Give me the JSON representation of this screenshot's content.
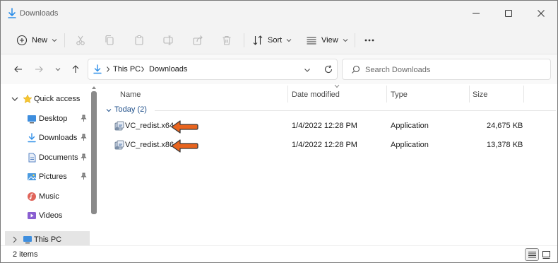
{
  "window": {
    "title": "Downloads"
  },
  "commandbar": {
    "new_label": "New",
    "sort_label": "Sort",
    "view_label": "View"
  },
  "address": {
    "crumbs": [
      "This PC",
      "Downloads"
    ]
  },
  "search": {
    "placeholder": "Search Downloads"
  },
  "navpane": {
    "quick_access": "Quick access",
    "items": [
      {
        "label": "Desktop",
        "icon": "desktop-icon"
      },
      {
        "label": "Downloads",
        "icon": "downloads-icon"
      },
      {
        "label": "Documents",
        "icon": "documents-icon"
      },
      {
        "label": "Pictures",
        "icon": "pictures-icon"
      },
      {
        "label": "Music",
        "icon": "music-icon"
      },
      {
        "label": "Videos",
        "icon": "videos-icon"
      }
    ],
    "this_pc": "This PC"
  },
  "columns": {
    "name": "Name",
    "date": "Date modified",
    "type": "Type",
    "size": "Size"
  },
  "group": {
    "label": "Today (2)"
  },
  "files": [
    {
      "name": "VC_redist.x64",
      "date": "1/4/2022 12:28 PM",
      "type": "Application",
      "size": "24,675 KB"
    },
    {
      "name": "VC_redist.x86",
      "date": "1/4/2022 12:28 PM",
      "type": "Application",
      "size": "13,378 KB"
    }
  ],
  "status": {
    "count": "2 items"
  },
  "colors": {
    "accent": "#0067c0",
    "arrow": "#e8641e",
    "folder": "#ffc83d"
  }
}
